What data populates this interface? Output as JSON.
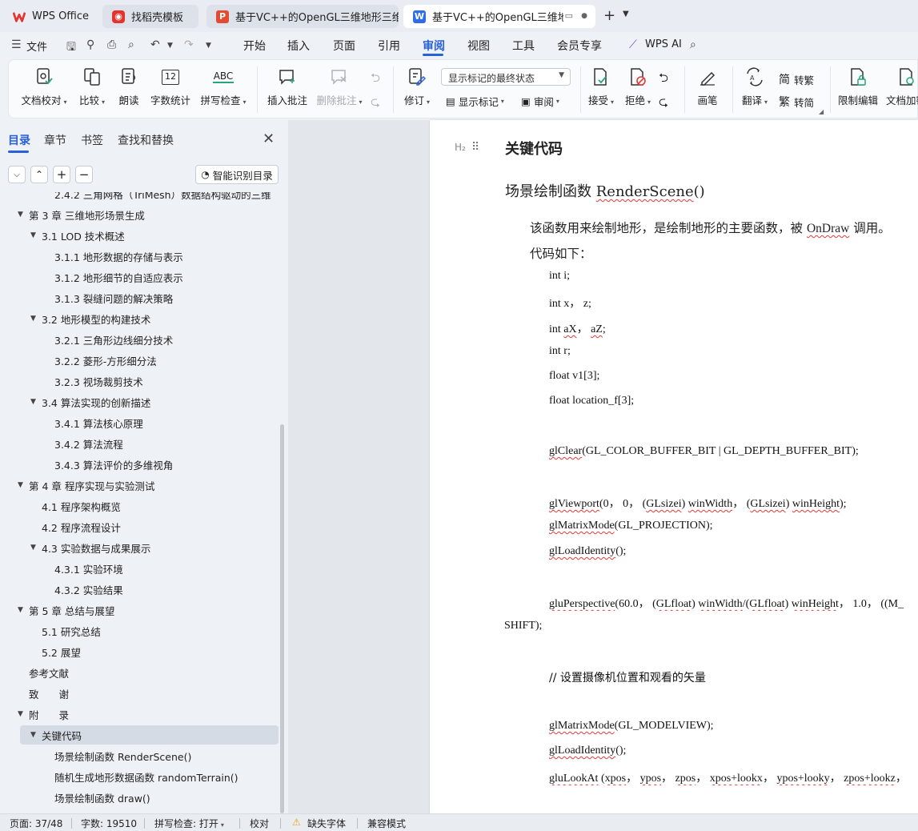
{
  "tabs": [
    {
      "label": "WPS Office",
      "icon": "wps-logo-icon"
    },
    {
      "label": "找稻壳模板",
      "icon": "docer-icon"
    },
    {
      "label": "基于VC++的OpenGL三维地形三维可",
      "icon": "pdf-icon"
    },
    {
      "label": "基于VC++的OpenGL三维地形",
      "icon": "word-doc-icon"
    }
  ],
  "menu": {
    "file": "文件",
    "items": [
      "开始",
      "插入",
      "页面",
      "引用",
      "审阅",
      "视图",
      "工具",
      "会员专享"
    ],
    "active": "审阅",
    "wps_ai": "WPS AI"
  },
  "ribbon": {
    "doc_check": "文档校对",
    "compare": "比较",
    "read_aloud": "朗读",
    "word_count": "字数统计",
    "spell_check": "拼写检查",
    "spell_icon_text": "ABC",
    "count_icon_text": "12",
    "insert_comment": "插入批注",
    "delete_comment": "删除批注",
    "revise": "修订",
    "markup_select": "显示标记的最终状态",
    "show_markup": "显示标记",
    "review": "审阅",
    "accept": "接受",
    "reject": "拒绝",
    "pen": "画笔",
    "translate": "翻译",
    "to_traditional": "转繁",
    "to_simplified": "转简",
    "simp_glyph": "简",
    "trad_glyph": "繁",
    "restrict_edit": "限制编辑",
    "doc_encrypt": "文档加密"
  },
  "nav": {
    "tabs": [
      "目录",
      "章节",
      "书签",
      "查找和替换"
    ],
    "smart_toc": "智能识别目录",
    "toc": [
      {
        "label": "2.4.2 三角网格（TriMesh）数据结构驱动的三维…",
        "level": 3,
        "arrow": false
      },
      {
        "label": "第 3 章  三维地形场景生成",
        "level": 1,
        "arrow": true
      },
      {
        "label": "3.1 LOD 技术概述",
        "level": 2,
        "arrow": true
      },
      {
        "label": "3.1.1  地形数据的存储与表示",
        "level": 3,
        "arrow": false
      },
      {
        "label": "3.1.2  地形细节的自适应表示",
        "level": 3,
        "arrow": false
      },
      {
        "label": "3.1.3  裂缝问题的解决策略",
        "level": 3,
        "arrow": false
      },
      {
        "label": "3.2  地形模型的构建技术",
        "level": 2,
        "arrow": true
      },
      {
        "label": "3.2.1  三角形边线细分技术",
        "level": 3,
        "arrow": false
      },
      {
        "label": "3.2.2  菱形-方形细分法",
        "level": 3,
        "arrow": false
      },
      {
        "label": "3.2.3  视场裁剪技术",
        "level": 3,
        "arrow": false
      },
      {
        "label": "3.4  算法实现的创新描述",
        "level": 2,
        "arrow": true
      },
      {
        "label": "3.4.1  算法核心原理",
        "level": 3,
        "arrow": false
      },
      {
        "label": "3.4.2  算法流程",
        "level": 3,
        "arrow": false
      },
      {
        "label": "3.4.3  算法评价的多维视角",
        "level": 3,
        "arrow": false
      },
      {
        "label": "第 4 章  程序实现与实验测试",
        "level": 1,
        "arrow": true
      },
      {
        "label": "4.1  程序架构概览",
        "level": 2,
        "arrow": false
      },
      {
        "label": "4.2  程序流程设计",
        "level": 2,
        "arrow": false
      },
      {
        "label": "4.3  实验数据与成果展示",
        "level": 2,
        "arrow": true
      },
      {
        "label": "4.3.1  实验环境",
        "level": 3,
        "arrow": false
      },
      {
        "label": "4.3.2  实验结果",
        "level": 3,
        "arrow": false
      },
      {
        "label": "第 5 章  总结与展望",
        "level": 1,
        "arrow": true
      },
      {
        "label": "5.1  研究总结",
        "level": 2,
        "arrow": false
      },
      {
        "label": "5.2  展望",
        "level": 2,
        "arrow": false
      },
      {
        "label": "参考文献",
        "level": 1,
        "arrow": false
      },
      {
        "label": "致　　谢",
        "level": 1,
        "arrow": false
      },
      {
        "label": "附　　录",
        "level": 1,
        "arrow": true
      },
      {
        "label": "关键代码",
        "level": 2,
        "arrow": true,
        "selected": true
      },
      {
        "label": "场景绘制函数 RenderScene()",
        "level": 3,
        "arrow": false
      },
      {
        "label": "随机生成地形数据函数 randomTerrain()",
        "level": 3,
        "arrow": false
      },
      {
        "label": "场景绘制函数 draw()",
        "level": 3,
        "arrow": false
      }
    ]
  },
  "document": {
    "heading_marker": "H₂",
    "heading": "关键代码",
    "subheading_pre": "场景绘制函数 ",
    "subheading_fn": "RenderScene",
    "subheading_post": "()",
    "para1_pre": "该函数用来绘制地形，是绘制地形的主要函数，被 ",
    "para1_fn": "OnDraw",
    "para1_post": " 调用。",
    "para2": "代码如下：",
    "code": {
      "l1": "int i;",
      "l2": "int x，  z;",
      "l3_pre": "int ",
      "l3_a": "aX",
      "l3_mid": "，  ",
      "l3_b": "aZ",
      "l3_post": ";",
      "l4": "int r;",
      "l5": "float v1[3];",
      "l6": "float location_f[3];",
      "l7_fn": "glClear",
      "l7_rest": "(GL_COLOR_BUFFER_BIT | GL_DEPTH_BUFFER_BIT);",
      "l8_fn": "glViewport",
      "l8_a": "(0，  0，  (",
      "l8_t1": "GLsizei",
      "l8_b": ") ",
      "l8_v1": "winWidth",
      "l8_c": "，  (",
      "l8_t2": "GLsizei",
      "l8_d": ") ",
      "l8_v2": "winHeight",
      "l8_e": ");",
      "l9_fn": "glMatrixMode",
      "l9_rest": "(GL_PROJECTION);",
      "l10_fn": "glLoadIdentity",
      "l10_rest": "();",
      "l11_fn": "gluPerspective",
      "l11_a": "(60.0，  (",
      "l11_t1": "GLfloat",
      "l11_b": ") ",
      "l11_v1": "winWidth",
      "l11_c": "/(",
      "l11_t2": "GLfloat",
      "l11_d": ") ",
      "l11_v2": "winHeight",
      "l11_e": "，  1.0，  ((M_",
      "l11_wrap": "SHIFT);",
      "l12": "//  设置摄像机位置和观看的矢量",
      "l13_fn": "glMatrixMode",
      "l13_rest": "(GL_MODELVIEW);",
      "l14_fn": "glLoadIdentity",
      "l14_rest": "();",
      "l15_fn": "gluLookAt",
      "l15_a": " (",
      "l15_p1": "xpos",
      "l15_b": "，  ",
      "l15_p2": "ypos",
      "l15_c": "，  ",
      "l15_p3": "zpos",
      "l15_d": "，  ",
      "l15_p4": "xpos+lookx",
      "l15_e": "，  ",
      "l15_p5": "ypos+looky",
      "l15_f": "，  ",
      "l15_p6": "zpos+lookz",
      "l15_g": "，"
    }
  },
  "status": {
    "page": "页面: 37/48",
    "words": "字数: 19510",
    "spell": "拼写检查: 打开",
    "proof": "校对",
    "missing_font": "缺失字体",
    "compat": "兼容模式"
  },
  "colors": {
    "accent": "#2760d8",
    "wps_red": "#e5322d",
    "pdf_red": "#e34a2f",
    "word_blue": "#2f6ce5"
  }
}
